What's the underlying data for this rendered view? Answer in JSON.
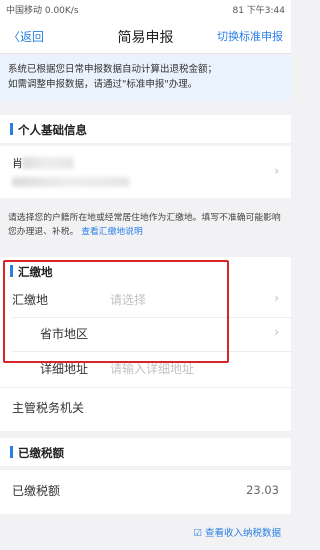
{
  "status_bar": {
    "left": "中国移动 0.00K/s",
    "right": "81 下午3:44"
  },
  "nav": {
    "back_label": "〈返回",
    "title": "简易申报",
    "switch_label": "切换标准申报"
  },
  "notice": {
    "line1": "系统已根据您日常申报数据自动计算出退税金额；",
    "line2": "如需调整申报数据，请通过\"标准申报\"办理。"
  },
  "sections": {
    "personal": "个人基础信息",
    "pay_place": "汇缴地",
    "paid_tax": "已缴税额"
  },
  "personal": {
    "name_char": "肖"
  },
  "info": {
    "text": "请选择您的户籍所在地或经常居住地作为汇缴地。填写不准确可能影响您办理退、补税。",
    "link": "查看汇缴地说明"
  },
  "form": {
    "pay_place_label": "汇缴地",
    "pay_place_placeholder": "请选择",
    "province_label": "省市地区",
    "address_label": "详细地址",
    "address_placeholder": "请输入详细地址",
    "tax_office_label": "主管税务机关"
  },
  "paid": {
    "label": "已缴税额",
    "value": "23.03"
  },
  "bottom_link": "☑ 查看收入纳税数据",
  "icons": {
    "chevron": "chevron-right-icon"
  }
}
